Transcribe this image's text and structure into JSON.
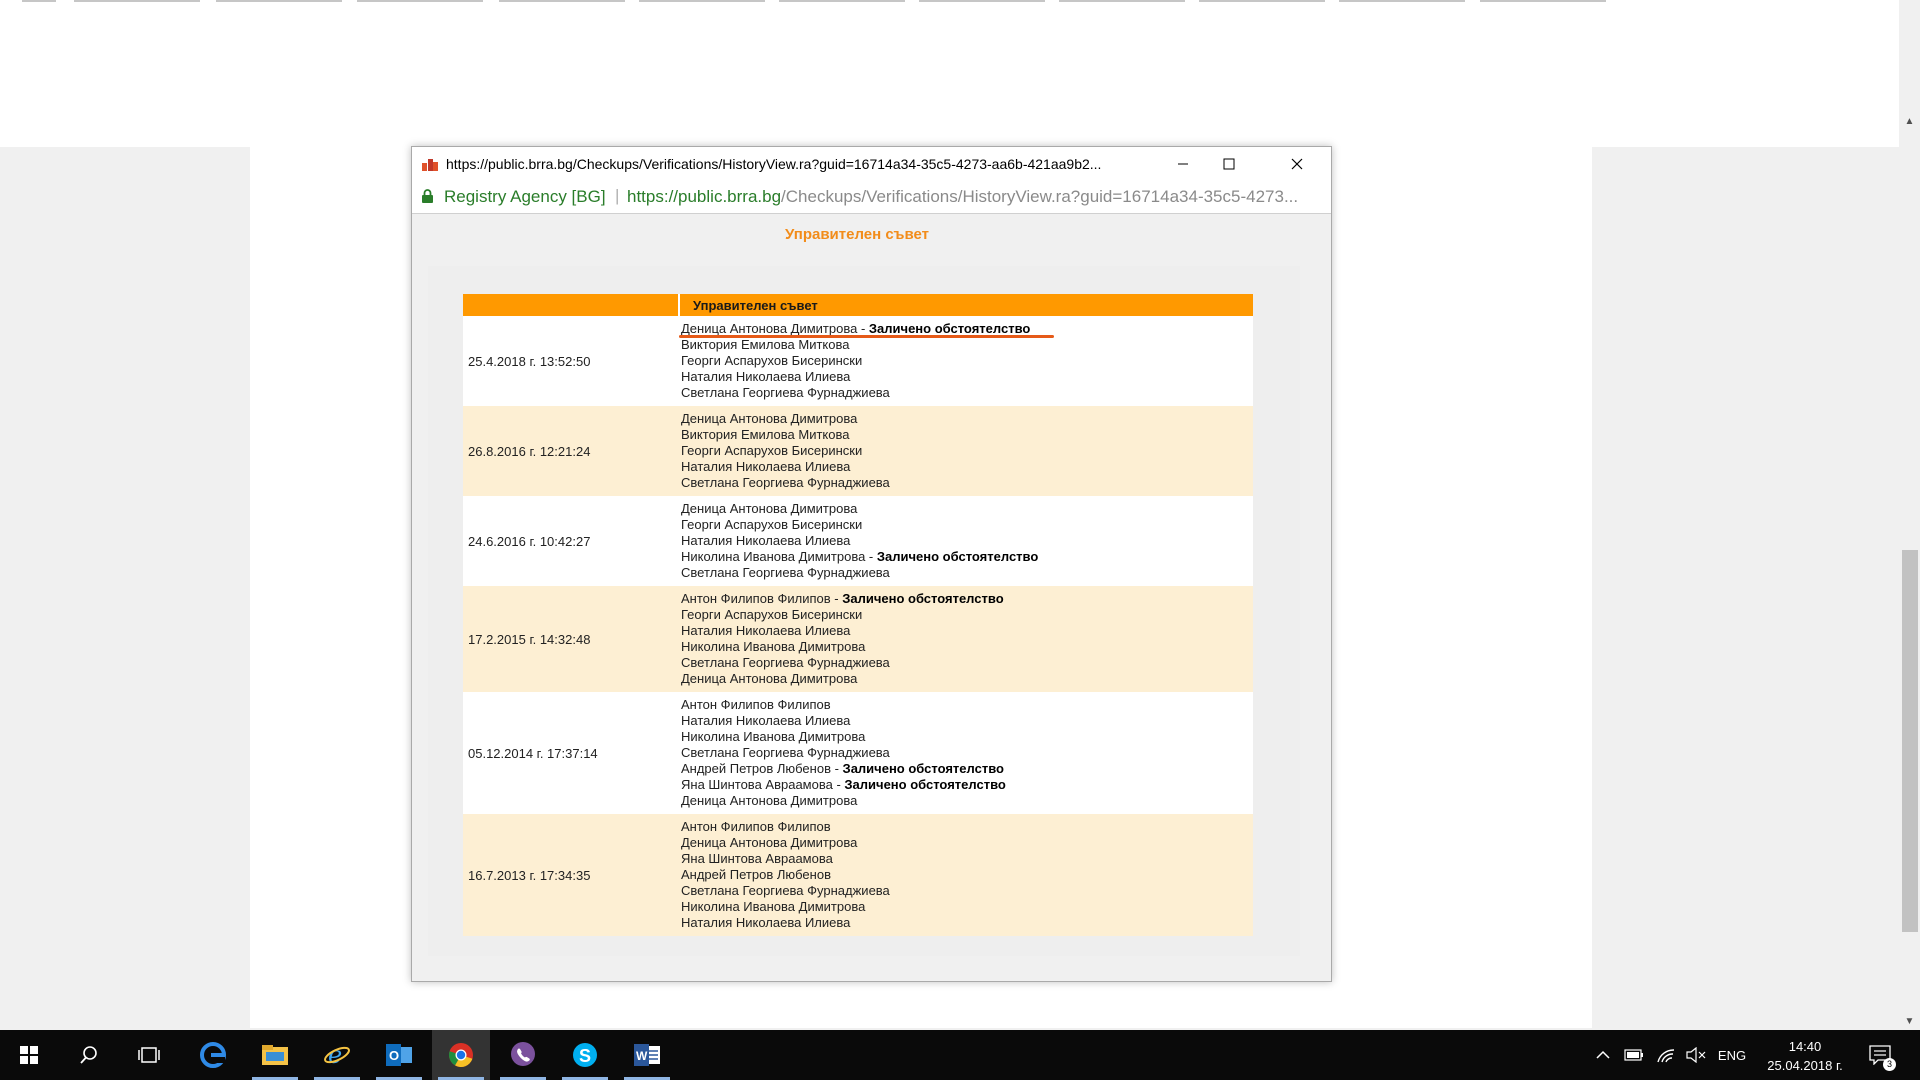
{
  "window": {
    "title": "https://public.brra.bg/Checkups/Verifications/HistoryView.ra?guid=16714a34-35c5-4273-aa6b-421aa9b2...",
    "site_name": "Registry Agency [BG]",
    "address_separator": "|",
    "url_host": "https://public.brra.bg",
    "url_path": "/Checkups/Verifications/HistoryView.ra?guid=16714a34-35c5-4273..."
  },
  "content": {
    "heading": "Управителен съвет",
    "table_header": {
      "date": "",
      "names": "Управителен съвет"
    },
    "separator": " - ",
    "rows": [
      {
        "date": "25.4.2018 г. 13:52:50",
        "names": [
          {
            "name": "Деница Антонова Димитрова",
            "note": "Заличено обстоятелство"
          },
          {
            "name": "Виктория Емилова Миткова"
          },
          {
            "name": "Георги Аспарухов Бисерински"
          },
          {
            "name": "Наталия Николаева Илиева"
          },
          {
            "name": "Светлана Георгиева Фурнаджиева"
          }
        ]
      },
      {
        "date": "26.8.2016 г. 12:21:24",
        "names": [
          {
            "name": "Деница Антонова Димитрова"
          },
          {
            "name": "Виктория Емилова Миткова"
          },
          {
            "name": "Георги Аспарухов Бисерински"
          },
          {
            "name": "Наталия Николаева Илиева"
          },
          {
            "name": "Светлана Георгиева Фурнаджиева"
          }
        ]
      },
      {
        "date": "24.6.2016 г. 10:42:27",
        "names": [
          {
            "name": "Деница Антонова Димитрова"
          },
          {
            "name": "Георги Аспарухов Бисерински"
          },
          {
            "name": "Наталия Николаева Илиева"
          },
          {
            "name": "Николина Иванова Димитрова",
            "note": "Заличено обстоятелство"
          },
          {
            "name": "Светлана Георгиева Фурнаджиева"
          }
        ]
      },
      {
        "date": "17.2.2015 г. 14:32:48",
        "names": [
          {
            "name": "Антон Филипов Филипов",
            "note": "Заличено обстоятелство"
          },
          {
            "name": "Георги Аспарухов Бисерински"
          },
          {
            "name": "Наталия Николаева Илиева"
          },
          {
            "name": "Николина Иванова Димитрова"
          },
          {
            "name": "Светлана Георгиева Фурнаджиева"
          },
          {
            "name": "Деница Антонова Димитрова"
          }
        ]
      },
      {
        "date": "05.12.2014 г. 17:37:14",
        "names": [
          {
            "name": "Антон Филипов Филипов"
          },
          {
            "name": "Наталия Николаева Илиева"
          },
          {
            "name": "Николина Иванова Димитрова"
          },
          {
            "name": "Светлана Георгиева Фурнаджиева"
          },
          {
            "name": "Андрей Петров Любенов",
            "note": "Заличено обстоятелство"
          },
          {
            "name": "Яна Шинтова Авраамова",
            "note": "Заличено обстоятелство"
          },
          {
            "name": "Деница Антонова Димитрова"
          }
        ]
      },
      {
        "date": "16.7.2013 г. 17:34:35",
        "names": [
          {
            "name": "Антон Филипов Филипов"
          },
          {
            "name": "Деница Антонова Димитрова"
          },
          {
            "name": "Яна Шинтова Авраамова"
          },
          {
            "name": "Андрей Петров Любенов"
          },
          {
            "name": "Светлана Георгиева Фурнаджиева"
          },
          {
            "name": "Николина Иванова Димитрова"
          },
          {
            "name": "Наталия Николаева Илиева"
          }
        ]
      }
    ]
  },
  "taskbar": {
    "icons": [
      "windows-start-icon",
      "search-icon",
      "task-view-icon",
      "edge-icon",
      "file-explorer-icon",
      "internet-explorer-icon",
      "outlook-icon",
      "chrome-icon",
      "viber-icon",
      "skype-icon",
      "word-icon"
    ],
    "language": "ENG",
    "time": "14:40",
    "date": "25.04.2018 г.",
    "notification_count": "3"
  },
  "colors": {
    "accent_orange": "#ff9900",
    "heading_orange": "#f28c1a",
    "row_cream": "#fdefd3",
    "secure_green": "#2a7d2a",
    "annotation_red": "#e65a18"
  }
}
